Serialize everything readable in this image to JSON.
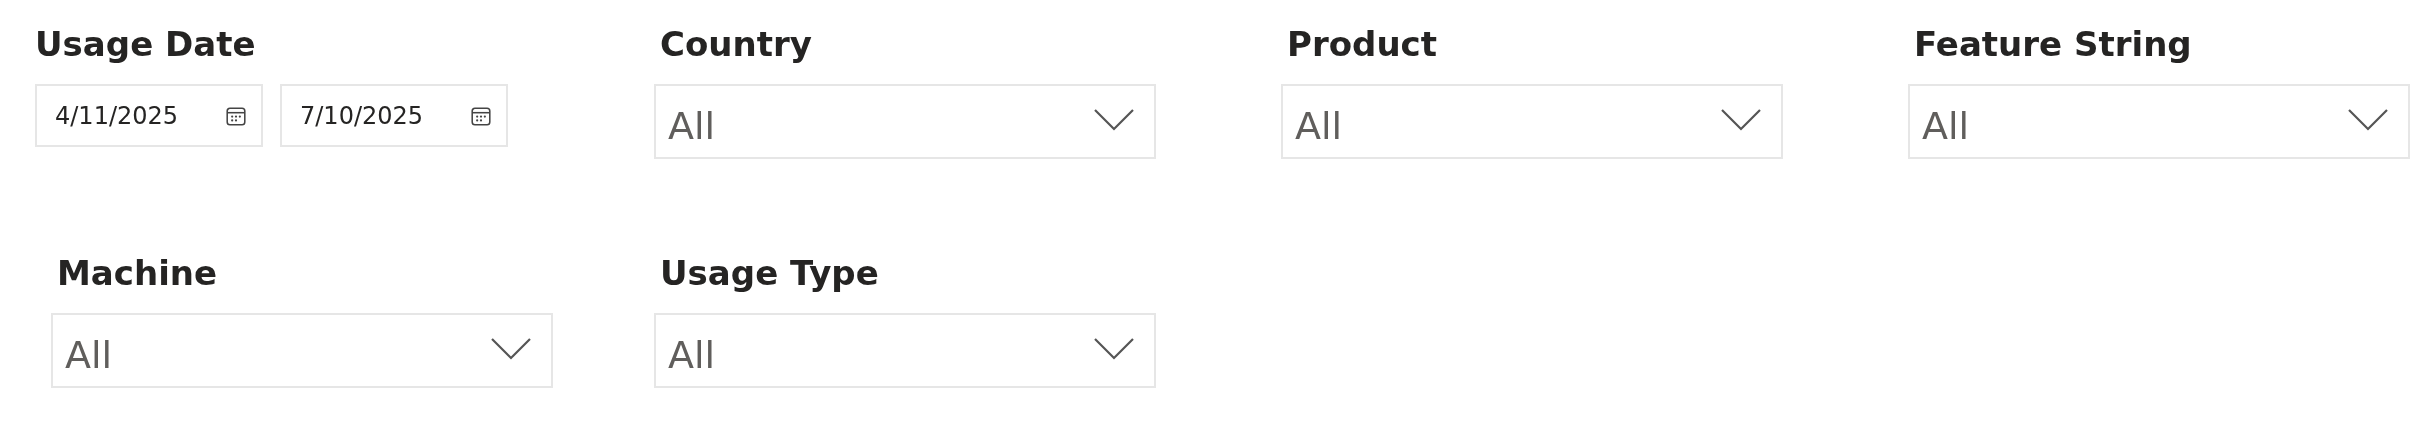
{
  "rows": [
    {
      "slicers": [
        {
          "kind": "date_range",
          "title": "Usage Date",
          "start": "4/11/2025",
          "end": "7/10/2025"
        },
        {
          "kind": "dropdown",
          "title": "Country",
          "value": "All"
        },
        {
          "kind": "dropdown",
          "title": "Product",
          "value": "All"
        },
        {
          "kind": "dropdown",
          "title": "Feature String",
          "value": "All"
        }
      ]
    },
    {
      "slicers": [
        {
          "kind": "dropdown",
          "title": "Machine",
          "value": "All"
        },
        {
          "kind": "dropdown",
          "title": "Usage Type",
          "value": "All"
        }
      ]
    }
  ]
}
